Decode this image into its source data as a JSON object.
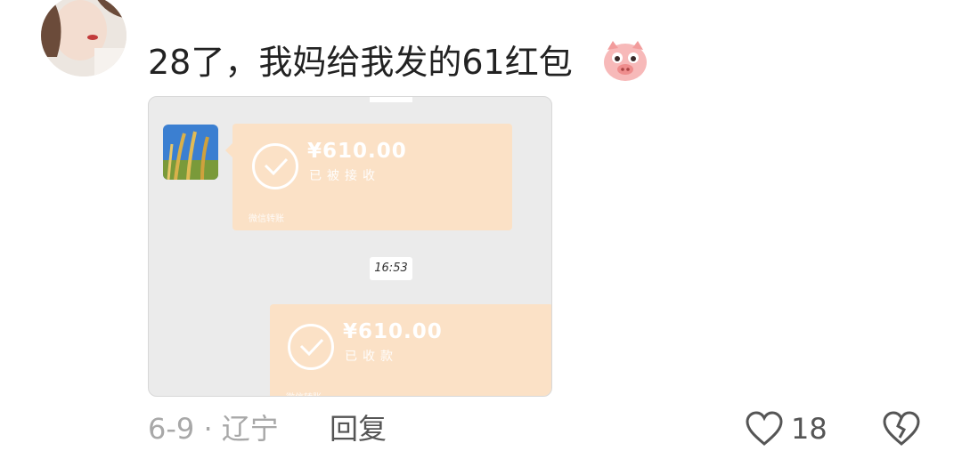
{
  "comment": {
    "text": "28了，我妈给我发的61红包",
    "emoji": "pig-face-icon"
  },
  "screenshot": {
    "transfer_sent": {
      "amount": "¥610.00",
      "status": "已被接收",
      "footer": "微信转账"
    },
    "time": "16:53",
    "transfer_received": {
      "amount": "¥610.00",
      "status": "已收款",
      "footer": "微信转账"
    }
  },
  "meta": {
    "date_location": "6-9 · 辽宁",
    "reply_label": "回复",
    "like_count": "18"
  },
  "colors": {
    "bubble": "#fbe1c6",
    "chat_bg": "#ebebeb",
    "meta_gray": "#a8a8a8"
  }
}
